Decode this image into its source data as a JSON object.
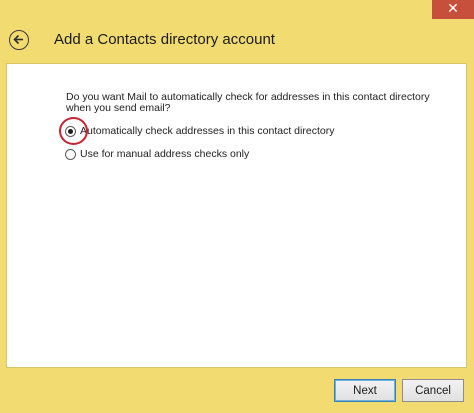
{
  "window": {
    "close_glyph": "✕"
  },
  "header": {
    "back_icon": "back-arrow-icon",
    "title": "Add a Contacts directory account"
  },
  "main": {
    "question": "Do you want Mail to automatically check for addresses in this contact directory when you send email?",
    "options": [
      {
        "label": "Automatically check addresses in this contact directory",
        "selected": true
      },
      {
        "label": "Use for manual address checks only",
        "selected": false
      }
    ]
  },
  "footer": {
    "next_label": "Next",
    "cancel_label": "Cancel"
  },
  "colors": {
    "frame": "#f2dc72",
    "close": "#c7503c",
    "highlight": "#c8202e"
  }
}
